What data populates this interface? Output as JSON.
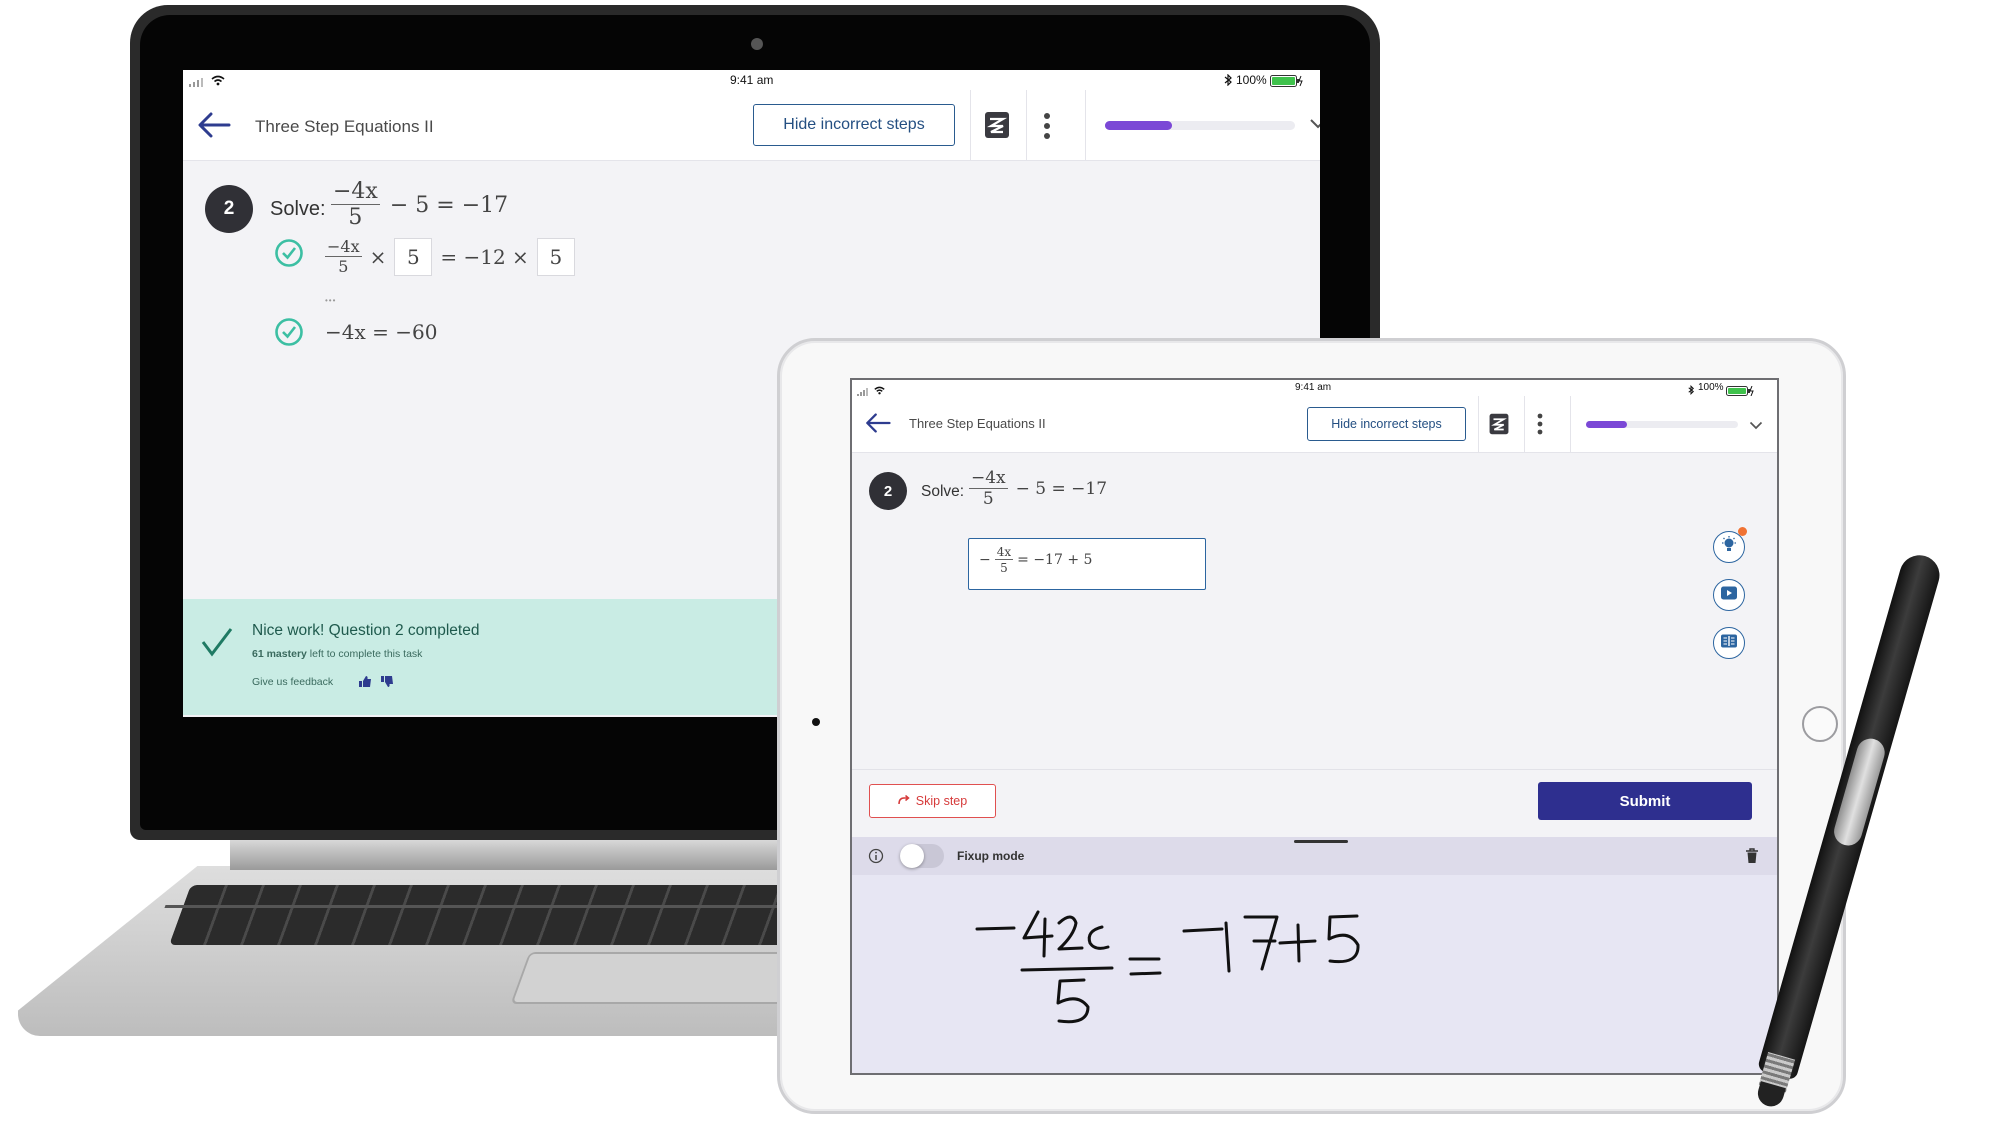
{
  "status_bar": {
    "time": "9:41 am",
    "battery": "100%"
  },
  "laptop": {
    "title": "Three Step Equations II",
    "hide_button": "Hide incorrect steps",
    "progress": 0.35,
    "question_number": "2",
    "solve_label": "Solve:",
    "problem": {
      "num": "−4x",
      "den": "5",
      "rest": "− 5 = −17"
    },
    "step1": {
      "num": "−4x",
      "den": "5",
      "times": "×",
      "box1": "5",
      "mid": "= −12 ×",
      "box2": "5"
    },
    "ellipsis": "•••",
    "step2": "−4x = −60",
    "feedback": {
      "title": "Nice work! Question 2 completed",
      "mastery_value": "61 mastery",
      "mastery_rest": " left to complete this task",
      "give_feedback": "Give us feedback"
    }
  },
  "tablet": {
    "title": "Three Step Equations II",
    "hide_button": "Hide incorrect steps",
    "progress": 0.27,
    "question_number": "2",
    "solve_label": "Solve:",
    "problem": {
      "num": "−4x",
      "den": "5",
      "rest": "− 5 = −17"
    },
    "answer": {
      "sign": "−",
      "num": "4x",
      "den": "5",
      "rest": "= −17 + 5"
    },
    "skip_button": "Skip step",
    "submit_button": "Submit",
    "fixup_label": "Fixup mode",
    "handwriting": "−4x/5 = −17+5"
  },
  "colors": {
    "accent_blue": "#244f82",
    "progress_purple": "#7b48d6",
    "submit_navy": "#2e2f8f",
    "success_green": "#3cbfa3",
    "feedback_bg": "#c9ece4",
    "skip_red": "#d63b3b"
  },
  "icons": [
    "wifi-icon",
    "signal-icon",
    "bluetooth-icon",
    "battery-icon",
    "back-arrow-icon",
    "notebook-icon",
    "more-vert-icon",
    "chevron-down-icon",
    "check-circle-icon",
    "checkmark-icon",
    "thumbs-up-icon",
    "thumbs-down-icon",
    "lightbulb-icon",
    "play-video-icon",
    "book-icon",
    "skip-icon",
    "info-icon",
    "trash-icon"
  ]
}
